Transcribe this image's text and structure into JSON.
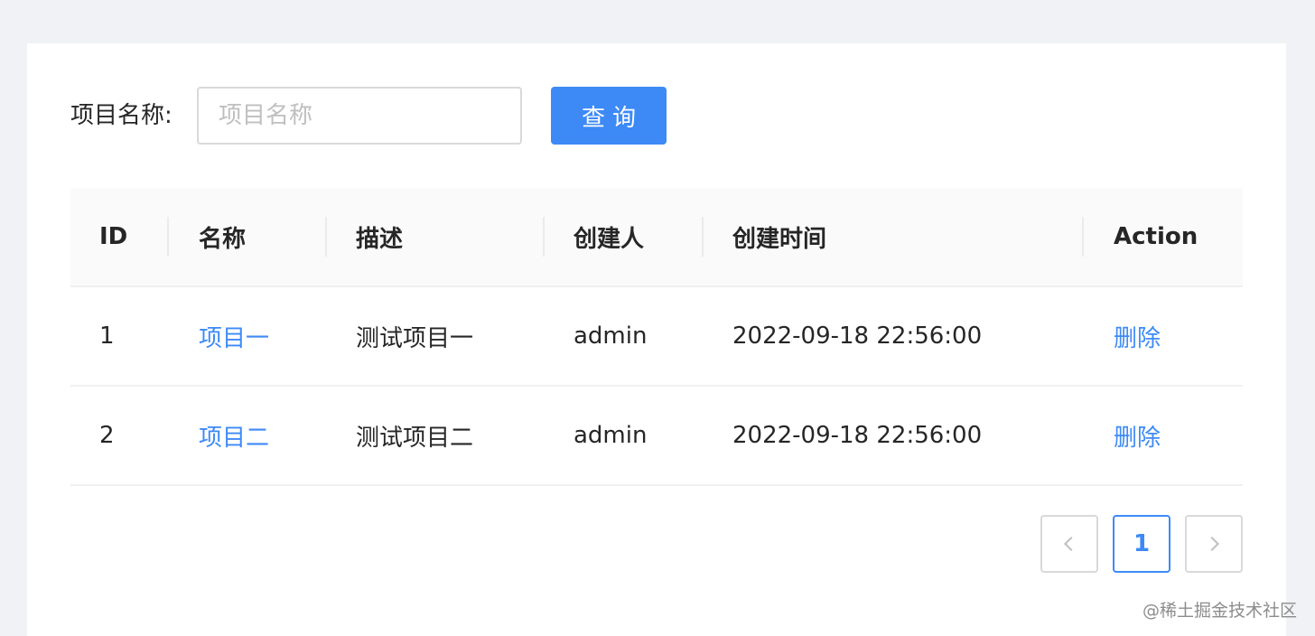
{
  "search": {
    "label": "项目名称:",
    "placeholder": "项目名称",
    "value": "",
    "button_label": "查询"
  },
  "table": {
    "columns": [
      "ID",
      "名称",
      "描述",
      "创建人",
      "创建时间",
      "Action"
    ],
    "rows": [
      {
        "id": "1",
        "name": "项目一",
        "description": "测试项目一",
        "creator": "admin",
        "created_at": "2022-09-18 22:56:00",
        "action": "删除"
      },
      {
        "id": "2",
        "name": "项目二",
        "description": "测试项目二",
        "creator": "admin",
        "created_at": "2022-09-18 22:56:00",
        "action": "删除"
      }
    ]
  },
  "pagination": {
    "current_page": "1",
    "prev_icon": "chevron-left-icon",
    "next_icon": "chevron-right-icon"
  },
  "watermark": "@稀土掘金技术社区",
  "colors": {
    "accent": "#3d8af7",
    "background": "#f0f2f5",
    "header_bg": "#fafafa"
  }
}
